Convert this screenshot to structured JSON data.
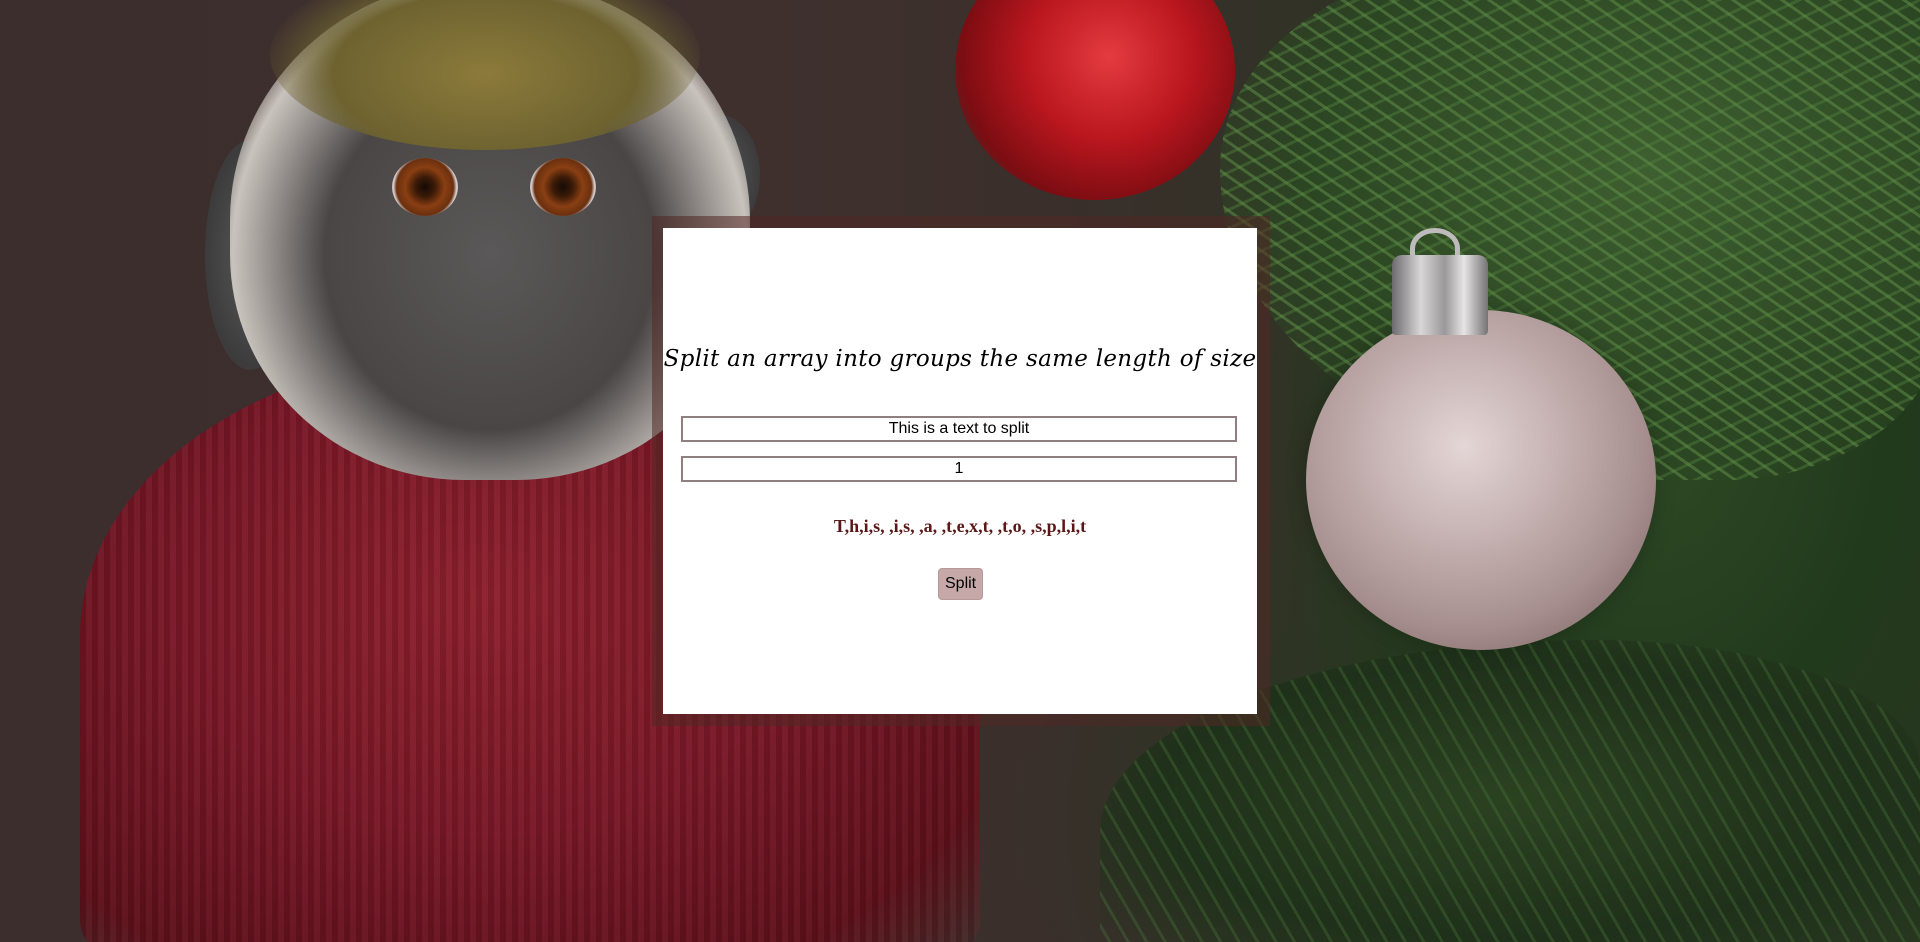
{
  "page": {
    "title": "Split an array into groups the same length of size"
  },
  "form": {
    "text_value": "This is a text to split",
    "size_value": "1",
    "result": "T,h,i,s, ,i,s, ,a, ,t,e,x,t, ,t,o, ,s,p,l,i,t",
    "split_label": "Split"
  },
  "colors": {
    "card_background": "#ffffff",
    "result_text": "#5a1717",
    "button_background": "#c7a8a8",
    "field_border": "#8f7f7f"
  }
}
